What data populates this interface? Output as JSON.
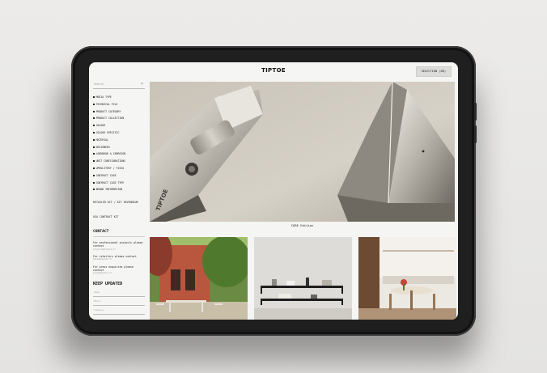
{
  "brand": {
    "logo": "TIPTOE"
  },
  "header": {
    "selection_label": "SELECTION (00)"
  },
  "search": {
    "placeholder": "Search"
  },
  "sidebar": {
    "filters": [
      "MEDIA TYPE",
      "TECHNICAL FILE",
      "PRODUCT CATEGORY",
      "PRODUCT COLLECTION",
      "COLOUR",
      "COLOUR SPECIFIC",
      "MATERIAL",
      "DESIGNERS",
      "LOOKBOOK & CAMPAIGN",
      "UNIT CONFIGURATIONS",
      "UPHOLSTERY / TISSU",
      "CONTRACT CASE",
      "CONTRACT CASE TYPE",
      "BRAND INFORMATION"
    ],
    "retailer_kit": "RETAILER KIT / KIT REVENDEUR",
    "contract_kit": "USA CONTRACT KIT"
  },
  "contact": {
    "title": "CONTACT",
    "blocks": [
      {
        "label": "For professional projects please contact",
        "email": "projects@tiptoe.fr"
      },
      {
        "label": "For retailers please contact",
        "email": "sales@tiptoe.fr"
      },
      {
        "label": "For press enquiries please contact",
        "email": "press@tiptoe.fr"
      }
    ]
  },
  "updates": {
    "title": "KEEP UPDATED",
    "fields": [
      "Name",
      "Email",
      "Company"
    ]
  },
  "main": {
    "hero_caption": "CORE Edition",
    "hero_engraving": "TIPTOE"
  },
  "colors": {
    "screen_bg": "#f5f5f3",
    "tablet_frame": "#1f1f20",
    "accent_text": "#111111"
  }
}
